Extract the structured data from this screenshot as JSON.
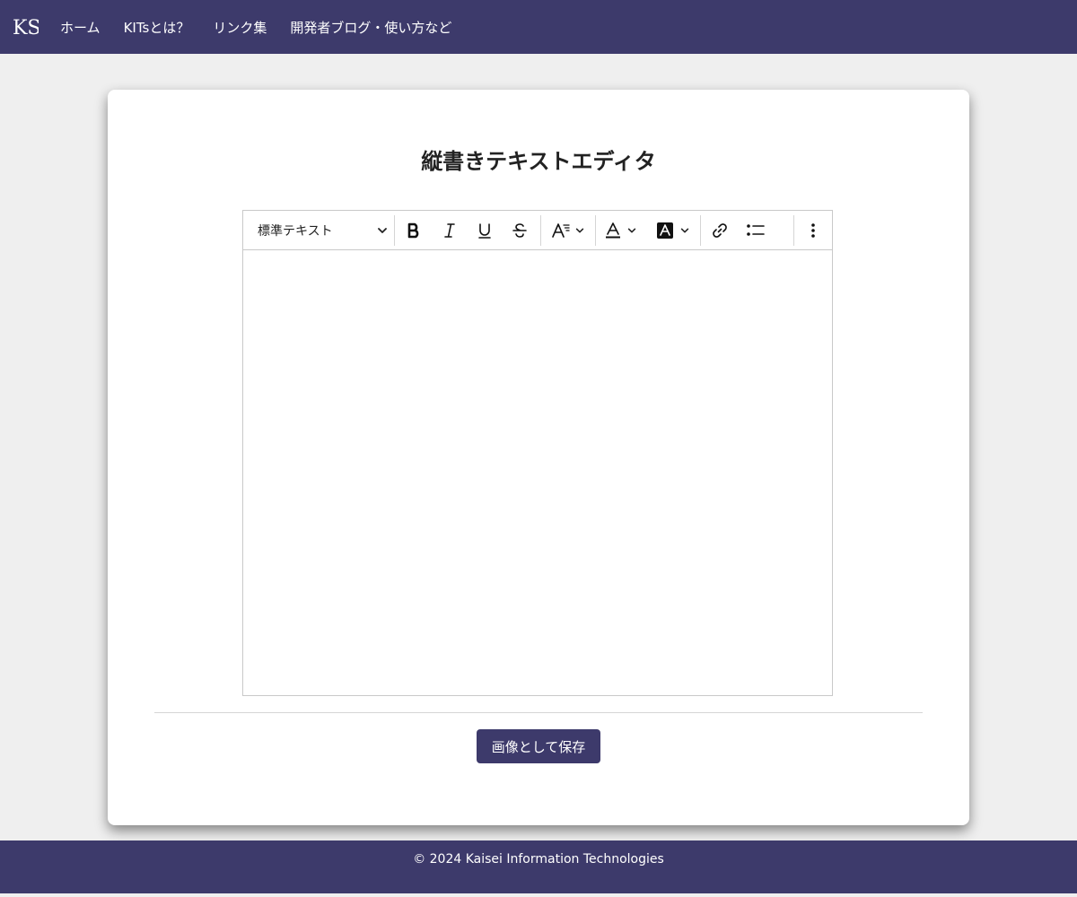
{
  "navbar": {
    "logo_text": "KS",
    "links": [
      {
        "label": "ホーム"
      },
      {
        "label": "KITsとは？"
      },
      {
        "label": "リンク集"
      },
      {
        "label": "開発者ブログ・使い方など"
      }
    ]
  },
  "main": {
    "title": "縦書きテキストエディタ",
    "toolbar": {
      "block_style": "標準テキスト",
      "icons": [
        "bold-icon",
        "italic-icon",
        "underline-icon",
        "strikethrough-icon",
        "font-size-icon",
        "font-color-icon",
        "highlight-icon",
        "link-icon",
        "bulleted-list-icon",
        "more-icon"
      ]
    },
    "save_label": "画像として保存"
  },
  "footer": {
    "copyright": "© 2024 Kaisei Information Technologies"
  },
  "colors": {
    "brand": "#3d3a6b",
    "background": "#efefef"
  }
}
